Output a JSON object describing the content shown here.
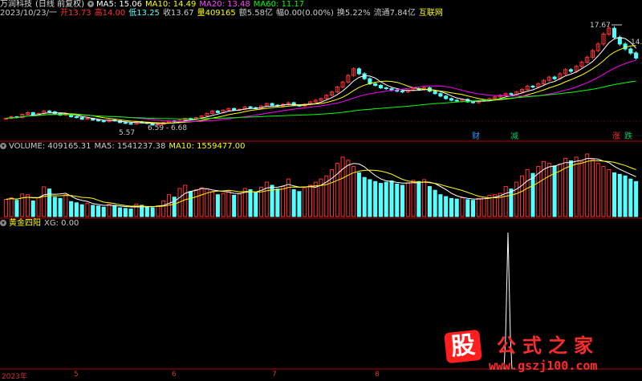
{
  "header": {
    "name": "万润科技",
    "period": "(日线 前复权)",
    "ma": [
      {
        "label": "MA5: 15.06",
        "color": "#ffffff"
      },
      {
        "label": "MA10: 14.49",
        "color": "#ffff00"
      },
      {
        "label": "MA20: 13.48",
        "color": "#ff00ff"
      },
      {
        "label": "MA60: 11.17",
        "color": "#00ff00"
      }
    ]
  },
  "quote": {
    "date": "2023/10/23/一",
    "open": "开13.73",
    "high": "高14.00",
    "low": "低13.25",
    "close": "收13.67",
    "volume": "量409165",
    "amount": "额5.58亿",
    "change": "幅0.00(0.00%)",
    "turnover": "换5.22%",
    "float_cap": "流通7.84亿",
    "sector": "互联网"
  },
  "price_labels": {
    "high_mark": "17.67",
    "low_mark": "5.57",
    "range_mark": "6.59 - 6.68",
    "right_a": "14.1",
    "right_b": "—"
  },
  "event_markers": [
    {
      "text": "财",
      "color": "#3399ff"
    },
    {
      "text": "减",
      "color": "#00cc66"
    },
    {
      "text": "涨",
      "color": "#ff3333"
    },
    {
      "text": "跌",
      "color": "#00cc66"
    }
  ],
  "volume_header": {
    "title": "VOLUME: 409165.31",
    "ma5": "MA5: 1541237.38",
    "ma10": "MA10: 1559477.00"
  },
  "indicator_header": {
    "title": "黄金四阳",
    "xg": "XG: 0.00"
  },
  "x_axis": {
    "year": "2023年",
    "months": [
      "5",
      "6",
      "7",
      "8"
    ]
  },
  "watermark": {
    "logo": "股",
    "title": "公式之家",
    "url": "www.gszj100.com"
  },
  "colors": {
    "up": "#ff3232",
    "down": "#54ffff",
    "ma5": "#ffffff",
    "ma10": "#ffff00",
    "ma20": "#ff00ff",
    "ma60": "#00ff00",
    "axis": "#b00000"
  },
  "chart_data": {
    "type": "bar",
    "title": "",
    "price_closes": [
      6.4,
      6.6,
      6.5,
      6.9,
      7.1,
      6.8,
      7.0,
      7.3,
      7.2,
      7.0,
      6.8,
      6.9,
      6.6,
      6.5,
      6.3,
      6.4,
      6.2,
      6.1,
      6.0,
      6.2,
      6.1,
      5.9,
      5.8,
      5.7,
      6.0,
      5.9,
      5.8,
      5.6,
      5.7,
      5.9,
      6.1,
      6.0,
      6.2,
      6.4,
      6.3,
      6.5,
      6.7,
      7.0,
      7.3,
      7.1,
      7.4,
      7.6,
      7.4,
      7.5,
      7.8,
      7.7,
      7.6,
      7.9,
      8.2,
      8.0,
      7.9,
      8.1,
      8.3,
      8.0,
      7.9,
      8.1,
      8.4,
      8.6,
      8.8,
      9.2,
      9.6,
      10.2,
      10.8,
      11.6,
      12.4,
      11.8,
      11.2,
      10.6,
      10.4,
      10.1,
      10.0,
      9.8,
      9.7,
      9.6,
      9.8,
      10.0,
      9.9,
      10.1,
      9.7,
      9.4,
      9.1,
      8.8,
      8.6,
      8.5,
      8.7,
      8.4,
      8.3,
      8.5,
      8.6,
      8.8,
      9.0,
      9.2,
      9.4,
      9.3,
      9.6,
      9.9,
      10.3,
      10.2,
      10.6,
      11.0,
      11.4,
      11.2,
      11.8,
      12.3,
      12.1,
      12.7,
      13.2,
      13.8,
      14.6,
      15.4,
      16.6,
      17.3,
      16.2,
      15.4,
      14.8,
      14.3,
      13.7
    ],
    "volumes": [
      55,
      60,
      52,
      72,
      70,
      50,
      60,
      95,
      88,
      62,
      58,
      70,
      48,
      44,
      38,
      42,
      36,
      34,
      30,
      40,
      36,
      28,
      26,
      24,
      40,
      36,
      30,
      28,
      34,
      50,
      70,
      62,
      90,
      100,
      80,
      86,
      92,
      88,
      78,
      70,
      74,
      82,
      68,
      72,
      90,
      86,
      76,
      94,
      110,
      100,
      88,
      96,
      120,
      86,
      80,
      92,
      100,
      110,
      120,
      130,
      150,
      170,
      190,
      180,
      160,
      140,
      125,
      118,
      112,
      106,
      110,
      114,
      104,
      100,
      108,
      116,
      112,
      118,
      96,
      84,
      70,
      64,
      58,
      56,
      60,
      54,
      52,
      58,
      62,
      68,
      70,
      74,
      96,
      88,
      110,
      130,
      150,
      138,
      160,
      176,
      170,
      162,
      168,
      186,
      178,
      190,
      175,
      200,
      182,
      170,
      160,
      150,
      140,
      135,
      130,
      120,
      112
    ]
  }
}
